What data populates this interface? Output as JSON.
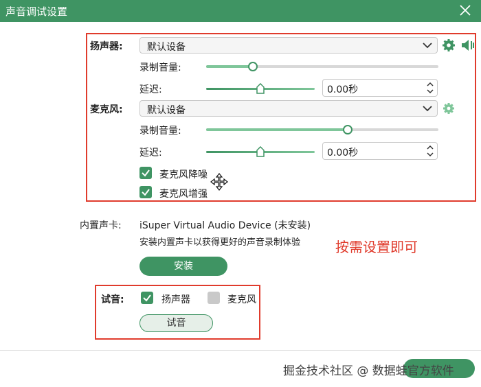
{
  "window": {
    "title": "声音调试设置"
  },
  "speaker": {
    "label": "扬声器:",
    "device": "默认设备",
    "record_volume_label": "录制音量:",
    "record_volume": 0.2,
    "delay_label": "延迟:",
    "delay_value": "0.00秒"
  },
  "mic": {
    "label": "麦克风:",
    "device": "默认设备",
    "record_volume_label": "录制音量:",
    "record_volume": 0.61,
    "delay_label": "延迟:",
    "delay_value": "0.00秒",
    "noise_reduction_label": "麦克风降噪",
    "enhance_label": "麦克风增强"
  },
  "builtin_card": {
    "label": "内置声卡:",
    "device_name": "iSuper Virtual Audio Device (未安装)",
    "hint": "安装内置声卡以获得更好的声音录制体验",
    "install_label": "安装"
  },
  "annotation": "按需设置即可",
  "test": {
    "label": "试音:",
    "speaker_label": "扬声器",
    "mic_label": "麦克风",
    "button_label": "试音"
  },
  "watermark": "掘金技术社区 @ 数据蛙官方软件",
  "colors": {
    "brand": "#3f9463",
    "annotation": "#e03b2c"
  }
}
